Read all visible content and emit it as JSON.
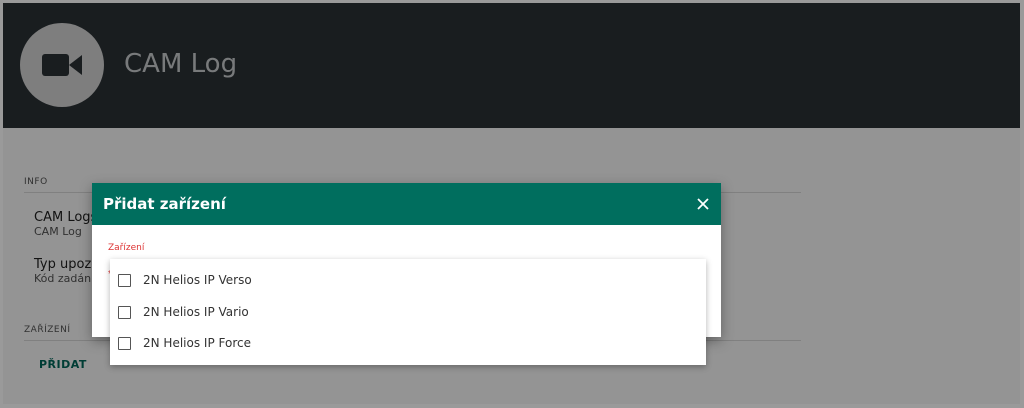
{
  "app": {
    "title": "CAM Log",
    "icon": "videocam-icon"
  },
  "info": {
    "section_label": "INFO",
    "fields": [
      {
        "name": "CAM Logs",
        "value": "CAM Log"
      },
      {
        "name": "Typ upozo",
        "value": "Kód zadán"
      }
    ]
  },
  "devices": {
    "section_label": "ZAŘÍZENÍ",
    "add_label": "PŘIDAT"
  },
  "dialog": {
    "title": "Přidat zařízení",
    "close_icon": "close-icon",
    "select_label": "Zařízení",
    "required_mark": "*",
    "options": [
      {
        "label": "2N Helios IP Verso",
        "checked": false
      },
      {
        "label": "2N Helios IP Vario",
        "checked": false
      },
      {
        "label": "2N Helios IP Force",
        "checked": false
      }
    ]
  },
  "colors": {
    "header_bg": "#2b3236",
    "dialog_header_bg": "#006e5e",
    "accent": "#00695c",
    "label_red": "#dd3333"
  }
}
